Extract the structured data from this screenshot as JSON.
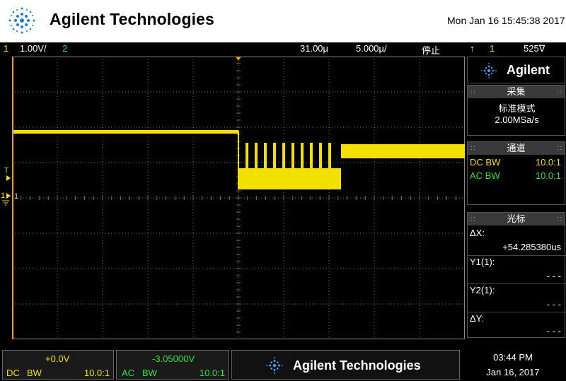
{
  "header": {
    "brand": "Agilent Technologies",
    "datetime": "Mon Jan 16 15:45:38 2017"
  },
  "status_bar": {
    "ch1_number": "1",
    "ch1_scale": "1.00V/",
    "ch2_number": "2",
    "trigger_delay": "31.00µ",
    "timebase": "5.000µ/",
    "run_state": "停止",
    "trigger_icon": "↑",
    "trigger_source": "1",
    "trigger_level": "525∇"
  },
  "screen": {
    "ch1_marker": "1",
    "trig_marker": "T",
    "ground_marker": "1"
  },
  "sidebar": {
    "brand": "Agilent",
    "acquire": {
      "title": "采集",
      "mode": "标准模式",
      "rate": "2.00MSa/s"
    },
    "channels": {
      "title": "通道",
      "rows": [
        {
          "coupling": "DC BW",
          "probe": "10.0:1"
        },
        {
          "coupling": "AC BW",
          "probe": "10.0:1"
        }
      ]
    },
    "cursors": {
      "title": "光标",
      "dx_label": "ΔX:",
      "dx_value": "+54.285380us",
      "y1_label": "Y1(1):",
      "y1_value": "- - -",
      "y2_label": "Y2(1):",
      "y2_value": "- - -",
      "dy_label": "ΔY:",
      "dy_value": "- - -"
    }
  },
  "footer": {
    "ch1": {
      "offset": "+0.0V",
      "coupling": "DC",
      "bw": "BW",
      "probe": "10.0:1"
    },
    "ch2": {
      "offset": "-3.05000V",
      "coupling": "AC",
      "bw": "BW",
      "probe": "10.0:1"
    },
    "brand": "Agilent Technologies",
    "time": "03:44 PM",
    "date": "Jan 16, 2017"
  },
  "colors": {
    "ch1": "#f2e100",
    "ch2": "#30e040",
    "grid": "#6a6a6a",
    "trigger_marker": "#f0a000"
  }
}
